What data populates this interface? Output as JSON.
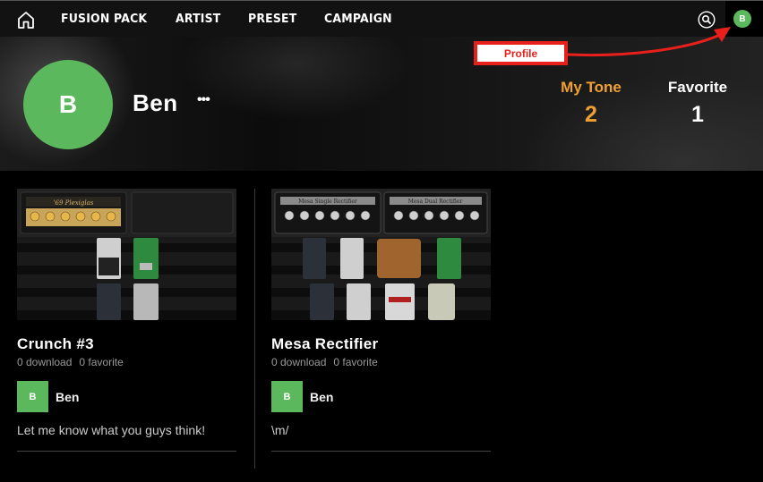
{
  "nav": {
    "home_icon": "home-icon",
    "links": [
      "FUSION PACK",
      "ARTIST",
      "PRESET",
      "CAMPAIGN"
    ],
    "search_icon": "search-icon",
    "profile_initial": "B"
  },
  "annotation": {
    "label": "Profile",
    "color": "#e8201c"
  },
  "profile": {
    "initial": "B",
    "name": "Ben",
    "more": "•••",
    "avatar_color": "#5cb85c",
    "stats": [
      {
        "label": "My Tone",
        "value": "2",
        "color": "#f0a030"
      },
      {
        "label": "Favorite",
        "value": "1",
        "color": "#ffffff"
      }
    ]
  },
  "tones": [
    {
      "title": "Crunch #3",
      "downloads": "0 download",
      "favorites": "0 favorite",
      "author_initial": "B",
      "author": "Ben",
      "comment": "Let me know what you guys think!",
      "amp_label": "'69 Plexiglas"
    },
    {
      "title": "Mesa Rectifier",
      "downloads": "0 download",
      "favorites": "0 favorite",
      "author_initial": "B",
      "author": "Ben",
      "comment": "\\m/",
      "amp_labels": [
        "Mesa Single Rectifier",
        "Mesa Dual Rectifier"
      ]
    }
  ]
}
